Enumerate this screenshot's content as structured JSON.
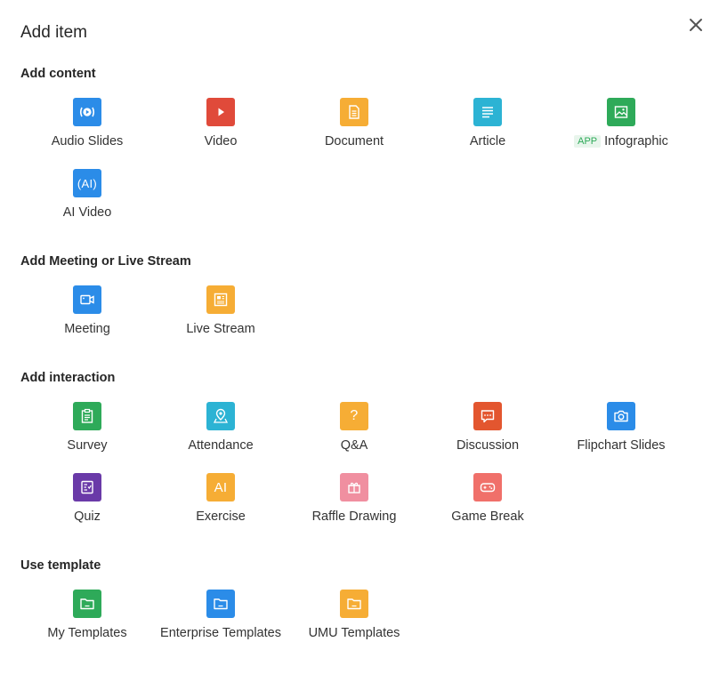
{
  "dialog": {
    "title": "Add item",
    "close_icon": "close-icon"
  },
  "sections": {
    "content": {
      "title": "Add content",
      "items": [
        {
          "label": "Audio Slides",
          "icon": "audio-slides-icon",
          "color": "#2b8ce8"
        },
        {
          "label": "Video",
          "icon": "video-play-icon",
          "color": "#e04a3a"
        },
        {
          "label": "Document",
          "icon": "document-icon",
          "color": "#f6ad35"
        },
        {
          "label": "Article",
          "icon": "article-icon",
          "color": "#2cb3d4"
        },
        {
          "label": "Infographic",
          "icon": "image-icon",
          "color": "#2eaa59",
          "badge": "APP"
        },
        {
          "label": "AI Video",
          "icon": "ai-video-icon",
          "color": "#2b8ce8",
          "glyph": "(AI)"
        }
      ]
    },
    "meeting": {
      "title": "Add Meeting or Live Stream",
      "items": [
        {
          "label": "Meeting",
          "icon": "camera-video-icon",
          "color": "#2b8ce8"
        },
        {
          "label": "Live Stream",
          "icon": "live-stream-icon",
          "color": "#f6ad35"
        }
      ]
    },
    "interaction": {
      "title": "Add interaction",
      "items": [
        {
          "label": "Survey",
          "icon": "clipboard-icon",
          "color": "#2eaa59"
        },
        {
          "label": "Attendance",
          "icon": "location-pin-icon",
          "color": "#2cb3d4"
        },
        {
          "label": "Q&A",
          "icon": "question-icon",
          "color": "#f6ad35",
          "glyph": "?"
        },
        {
          "label": "Discussion",
          "icon": "chat-bubble-icon",
          "color": "#e3562f"
        },
        {
          "label": "Flipchart Slides",
          "icon": "camera-icon",
          "color": "#2b8ce8"
        },
        {
          "label": "Quiz",
          "icon": "quiz-icon",
          "color": "#6a3aa8"
        },
        {
          "label": "Exercise",
          "icon": "ai-exercise-icon",
          "color": "#f6ad35",
          "glyph": "AI"
        },
        {
          "label": "Raffle Drawing",
          "icon": "gift-box-icon",
          "color": "#f08fa0"
        },
        {
          "label": "Game Break",
          "icon": "gamepad-icon",
          "color": "#f0706a"
        }
      ]
    },
    "template": {
      "title": "Use template",
      "items": [
        {
          "label": "My Templates",
          "icon": "folder-icon",
          "color": "#2eaa59"
        },
        {
          "label": "Enterprise Templates",
          "icon": "folder-icon",
          "color": "#2b8ce8"
        },
        {
          "label": "UMU Templates",
          "icon": "folder-icon",
          "color": "#f6ad35"
        }
      ]
    }
  }
}
